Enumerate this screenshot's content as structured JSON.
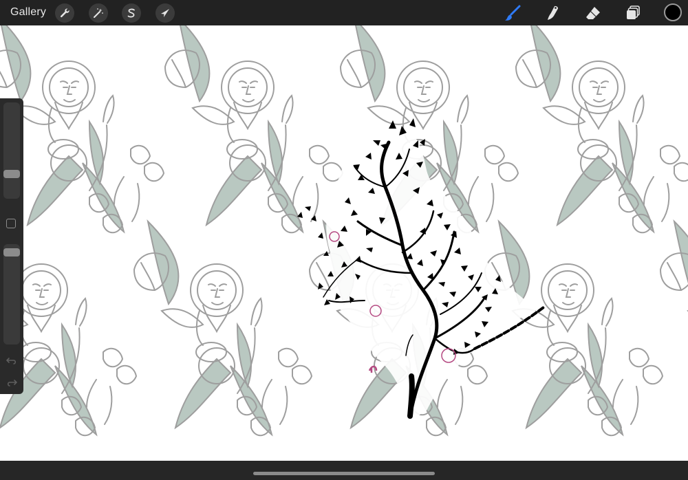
{
  "toolbar": {
    "gallery_label": "Gallery",
    "left_tools": [
      {
        "name": "actions",
        "icon": "wrench-icon"
      },
      {
        "name": "adjustments",
        "icon": "magic-wand-icon"
      },
      {
        "name": "selection",
        "icon": "selection-s-icon"
      },
      {
        "name": "transform",
        "icon": "arrow-cursor-icon"
      }
    ],
    "right_tools": [
      {
        "name": "brush",
        "icon": "paintbrush-icon",
        "active": true
      },
      {
        "name": "smudge",
        "icon": "smudge-finger-icon"
      },
      {
        "name": "eraser",
        "icon": "eraser-icon"
      },
      {
        "name": "layers",
        "icon": "layers-icon"
      }
    ],
    "current_color": "#000000",
    "accent_color": "#2f7bf6"
  },
  "sidebar": {
    "brush_size_level": 0.25,
    "opacity_level": 1.0,
    "modify_button_icon": "square-icon",
    "undo_icon": "undo-arrow-icon",
    "redo_icon": "redo-arrow-icon"
  },
  "canvas": {
    "background_color": "#ffffff",
    "pattern_line_color": "#9e9e9e",
    "pattern_leaf_color": "#b9c8c1",
    "ink_color": "#000000",
    "marker_color": "#b54a82"
  }
}
